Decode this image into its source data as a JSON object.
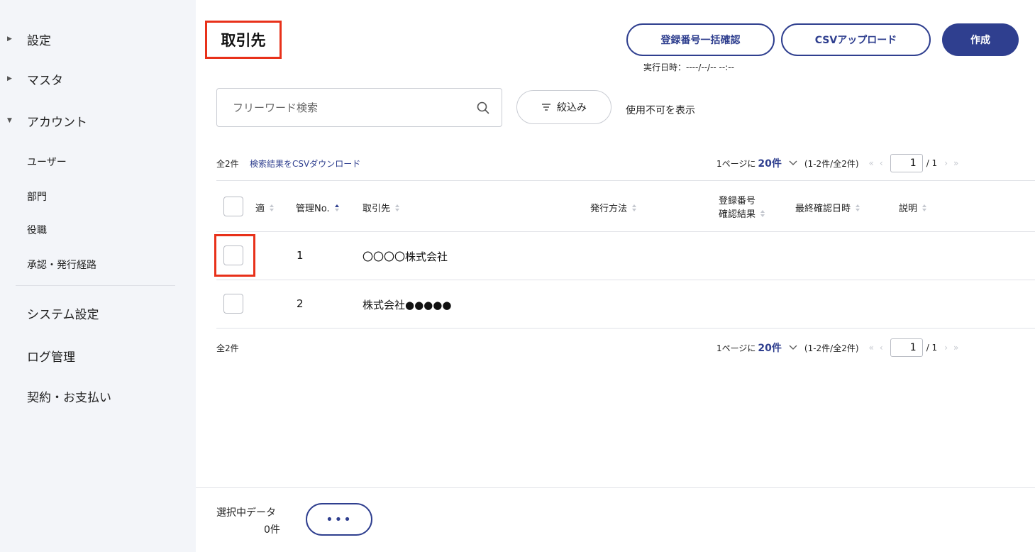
{
  "sidebar": {
    "groups": [
      {
        "label": "設定",
        "state": "collapsed"
      },
      {
        "label": "マスタ",
        "state": "collapsed"
      },
      {
        "label": "アカウント",
        "state": "expanded"
      }
    ],
    "account_items": [
      "ユーザー",
      "部門",
      "役職",
      "承認・発行経路"
    ],
    "bottom_items": [
      "システム設定",
      "ログ管理",
      "契約・お支払い"
    ]
  },
  "header": {
    "title": "取引先",
    "bulk_check_label": "登録番号一括確認",
    "csv_upload_label": "CSVアップロード",
    "create_label": "作成",
    "exec_time": "実行日時：----/--/-- --:--"
  },
  "search": {
    "placeholder": "フリーワード検索",
    "filter_label": "絞込み",
    "show_unusable_label": "使用不可を表示"
  },
  "list": {
    "count_top": "全2件",
    "csv_download_label": "検索結果をCSVダウンロード",
    "count_bottom": "全2件",
    "pager": {
      "per_page_prefix": "1ページに",
      "per_page_value": "20件",
      "range": "(1-2件/全2件)",
      "current_page": "1",
      "total_pages": "/ 1"
    },
    "columns": [
      "適",
      "管理No.",
      "取引先",
      "発行方法",
      "登録番号",
      "確認結果",
      "最終確認日時",
      "説明"
    ],
    "rows": [
      {
        "no": "1",
        "partner": "〇〇〇〇株式会社"
      },
      {
        "no": "2",
        "partner": "株式会社●●●●●"
      }
    ]
  },
  "footer": {
    "selected_label": "選択中データ",
    "selected_count": "0件",
    "more_label": "•••"
  },
  "colors": {
    "accent": "#2f3f8f",
    "highlight": "#e8311a",
    "sidebar_bg": "#f3f5f9"
  }
}
